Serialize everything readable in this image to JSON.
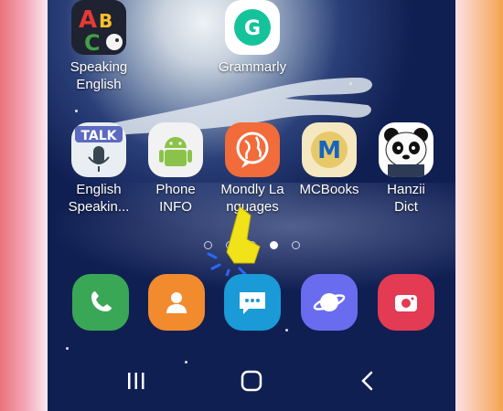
{
  "apps_row1": [
    {
      "label": "Speaking\nEnglish",
      "icon": "abc-icon"
    },
    {
      "label": "Grammarly",
      "icon": "grammarly-icon"
    }
  ],
  "apps_row2": [
    {
      "label": "English\nSpeakin...",
      "icon": "talk-microphone-icon"
    },
    {
      "label": "Phone\nINFO",
      "icon": "android-icon"
    },
    {
      "label": "Mondly La\nnguages",
      "icon": "mondly-globe-icon"
    },
    {
      "label": "MCBooks",
      "icon": "mcbooks-icon"
    },
    {
      "label": "Hanzii\nDict",
      "icon": "panda-icon"
    }
  ],
  "talk_text": "TALK",
  "mcbooks_letter": "M",
  "grammarly_letter": "G",
  "page_indicator": {
    "count": 5,
    "active_index": 3
  },
  "dock": [
    {
      "name": "phone-app",
      "icon": "phone-icon",
      "color": "#3aa757"
    },
    {
      "name": "contacts-app",
      "icon": "contact-icon",
      "color": "#f28a2e"
    },
    {
      "name": "messages-app",
      "icon": "chat-icon",
      "color": "#1a9ad6"
    },
    {
      "name": "internet-app",
      "icon": "planet-icon",
      "color": "#6a6cf0"
    },
    {
      "name": "camera-app",
      "icon": "camera-icon",
      "color": "#e23b53"
    }
  ],
  "navigation": {
    "recents": "recents-icon",
    "home": "home-icon",
    "back": "back-icon"
  }
}
